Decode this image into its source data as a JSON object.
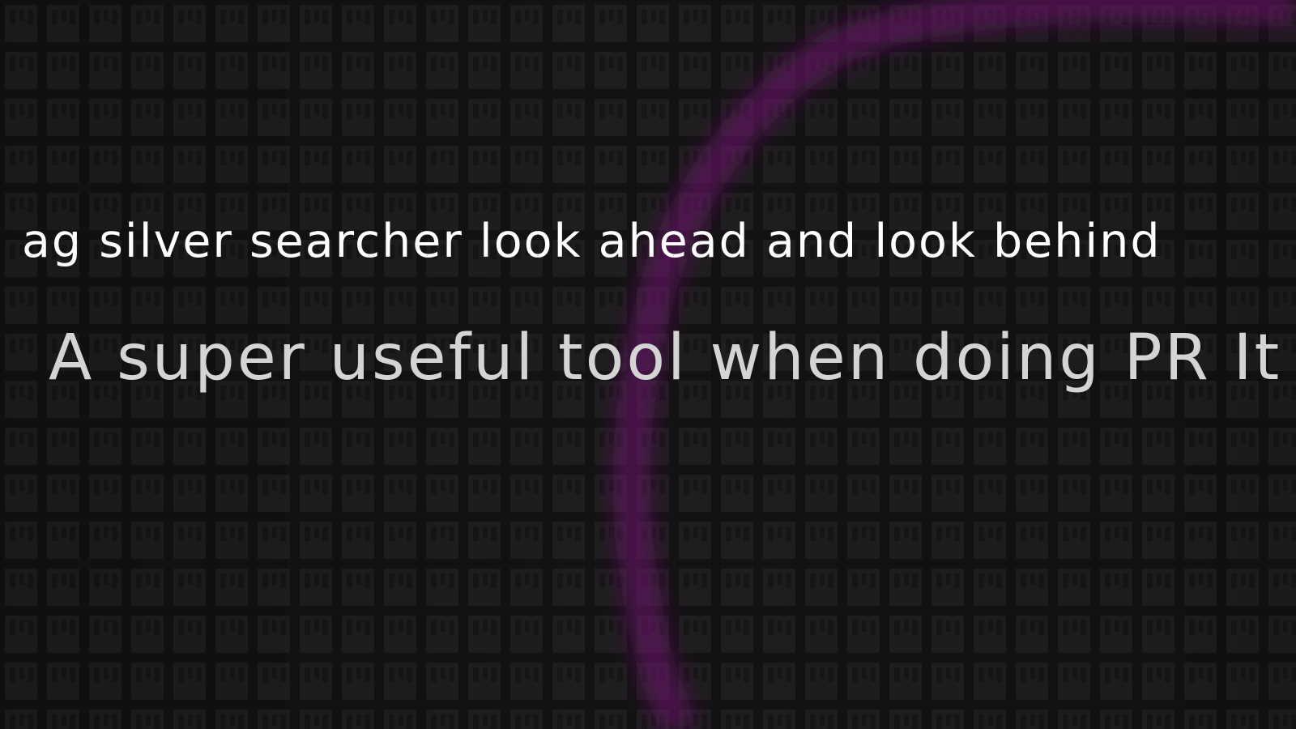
{
  "title": "ag silver searcher look ahead and look behind",
  "subtitle": "A super useful tool when doing PR It",
  "colors": {
    "background": "#161616",
    "tile": "#1e1e1e",
    "accent": "#7a1f7a",
    "title_text": "#ffffff",
    "subtitle_text": "#d4d4d4"
  }
}
